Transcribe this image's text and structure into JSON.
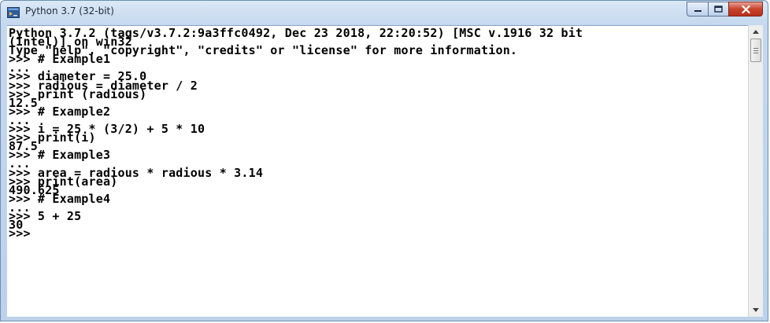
{
  "window": {
    "title": "Python 3.7 (32-bit)",
    "app_icon": "python-console-icon"
  },
  "caption_buttons": [
    {
      "name": "minimize-button",
      "icon": "minimize-icon"
    },
    {
      "name": "maximize-button",
      "icon": "maximize-icon"
    },
    {
      "name": "close-button",
      "icon": "close-icon",
      "color": "#c7432c"
    }
  ],
  "console": {
    "background": "#ffffff",
    "text_color": "#000000",
    "lines": [
      "Python 3.7.2 (tags/v3.7.2:9a3ffc0492, Dec 23 2018, 22:20:52) [MSC v.1916 32 bit",
      "(Intel)] on win32",
      "Type \"help\", \"copyright\", \"credits\" or \"license\" for more information.",
      ">>> # Example1",
      "...",
      ">>> diameter = 25.0",
      ">>> radious = diameter / 2",
      ">>> print (radious)",
      "12.5",
      ">>> # Example2",
      "...",
      ">>> i = 25 * (3/2) + 5 * 10",
      ">>> print(i)",
      "87.5",
      ">>> # Example3",
      "...",
      ">>> area = radious * radious * 3.14",
      ">>> print(area)",
      "490.625",
      ">>> # Example4",
      "...",
      ">>> 5 + 25",
      "30",
      ">>>"
    ]
  },
  "scrollbar": {
    "up_icon": "scroll-up-arrow-icon",
    "down_icon": "scroll-down-arrow-icon"
  }
}
